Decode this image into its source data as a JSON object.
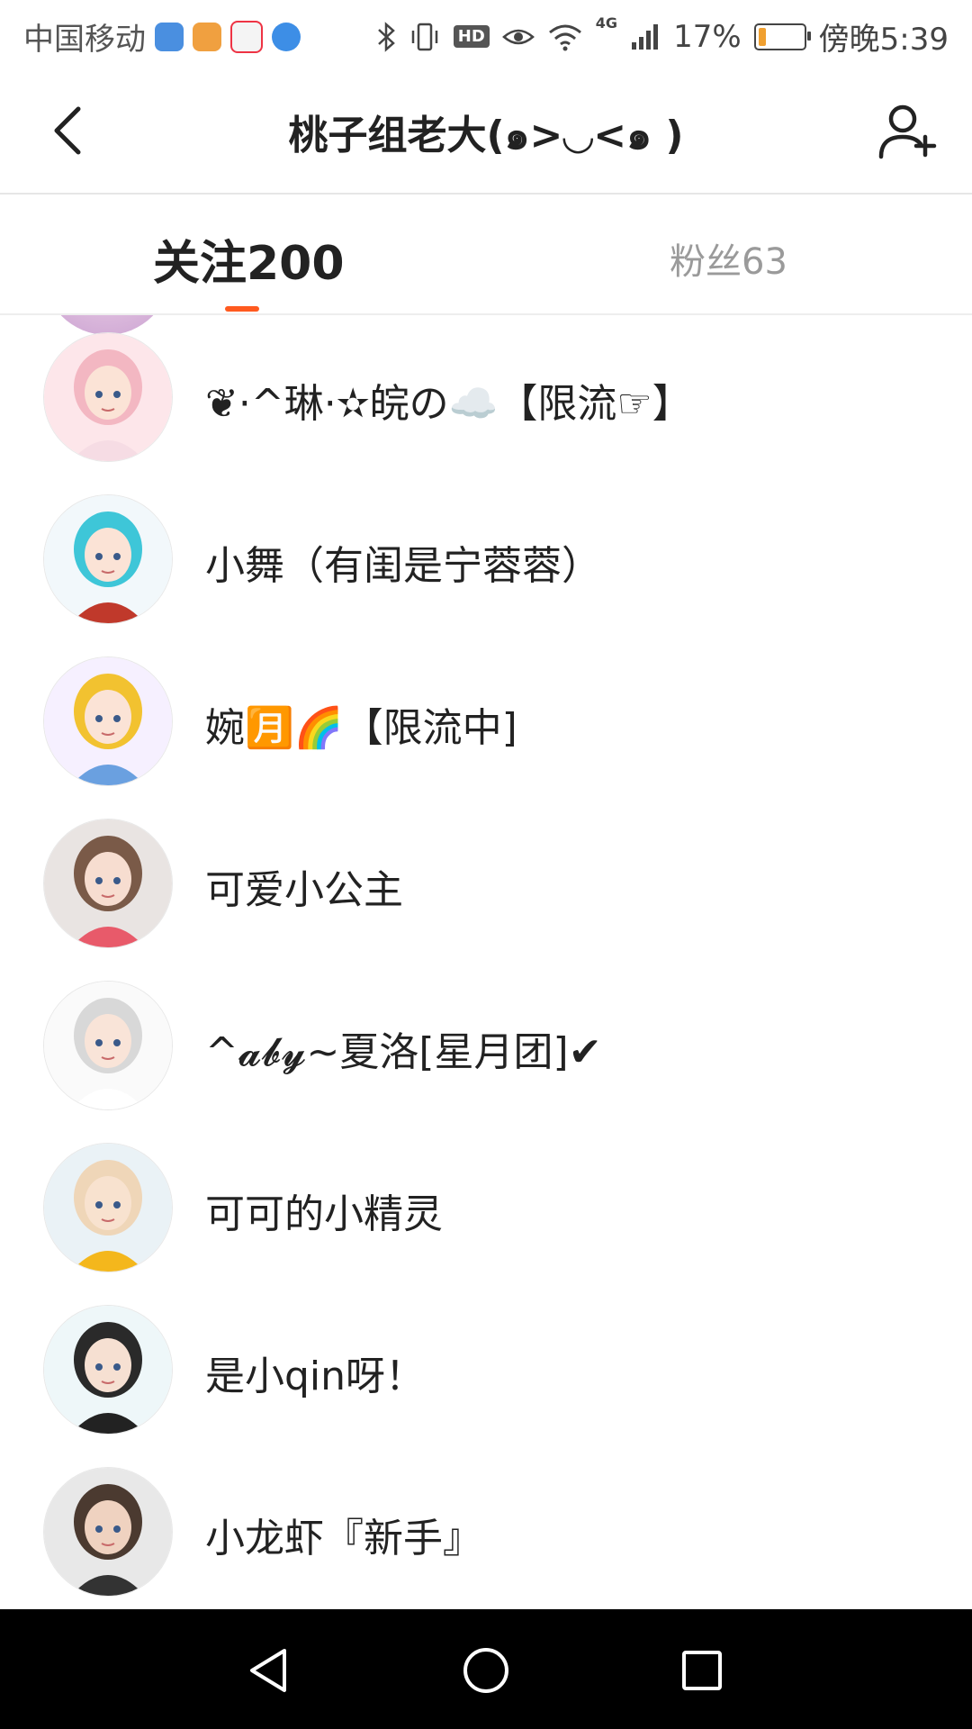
{
  "status_bar": {
    "carrier": "中国移动",
    "network": "4G",
    "battery_percent": "17%",
    "battery_level": 0.17,
    "time": "傍晚5:39",
    "hd_label": "HD",
    "left_icons": [
      "shield-app-icon",
      "video-app-icon",
      "baidu-app-icon",
      "browser-app-icon"
    ],
    "right_icons": [
      "bluetooth-icon",
      "vibrate-icon",
      "hd-icon",
      "eye-icon",
      "wifi-icon",
      "signal-icon",
      "battery-icon"
    ]
  },
  "header": {
    "title": "桃子组老大(๑>◡<๑ )",
    "back_icon": "back-arrow-icon",
    "add_icon": "add-user-icon"
  },
  "tabs": {
    "following_label": "关注200",
    "fans_label": "粉丝63",
    "active": "following",
    "indicator_color": "#ff5a1f"
  },
  "list": {
    "items": [
      {
        "name": "❦·^琳·✫皖の☁️【限流☞】",
        "avatar": "avatar-pink-girl"
      },
      {
        "name": "小舞（有闺是宁蓉蓉）",
        "avatar": "avatar-cyan-hair"
      },
      {
        "name": "婉🈷️🌈【限流中]",
        "avatar": "avatar-bunny-ears"
      },
      {
        "name": "可爱小公主",
        "avatar": "avatar-brown-hair"
      },
      {
        "name": "^𝓪𝓫𝔂~夏洛[星月团]✔",
        "avatar": "avatar-white-hair"
      },
      {
        "name": "可可的小精灵",
        "avatar": "avatar-sunflower"
      },
      {
        "name": "是小qin呀！",
        "avatar": "avatar-full-body"
      },
      {
        "name": "小龙虾『新手』",
        "avatar": "avatar-short-hair"
      }
    ]
  },
  "nav_bar": {
    "back_icon": "nav-back-icon",
    "home_icon": "nav-home-icon",
    "recents_icon": "nav-recents-icon"
  }
}
